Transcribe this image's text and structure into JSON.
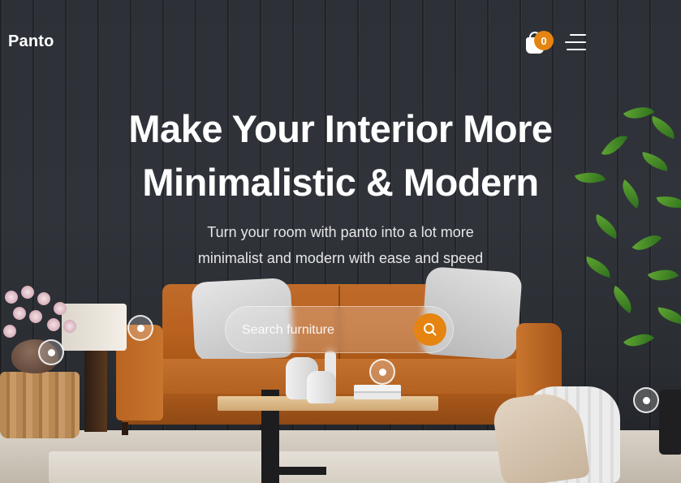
{
  "brand": {
    "name": "Panto"
  },
  "header": {
    "cart_count": "0",
    "cart_icon": "shopping-bag-icon",
    "menu_icon": "hamburger-menu-icon"
  },
  "hero": {
    "title_line1": "Make Your Interior More",
    "title_line2": "Minimalistic & Modern",
    "subtitle_line1": "Turn your room with panto into a lot more",
    "subtitle_line2": "minimalist and modern with ease and speed"
  },
  "search": {
    "placeholder": "Search furniture",
    "button_icon": "search-icon"
  },
  "hotspots": [
    "hotspot-lamp",
    "hotspot-bowl",
    "hotspot-vase",
    "hotspot-right"
  ],
  "colors": {
    "accent": "#E58411",
    "background": "#2D3137",
    "text": "#FFFFFF"
  }
}
